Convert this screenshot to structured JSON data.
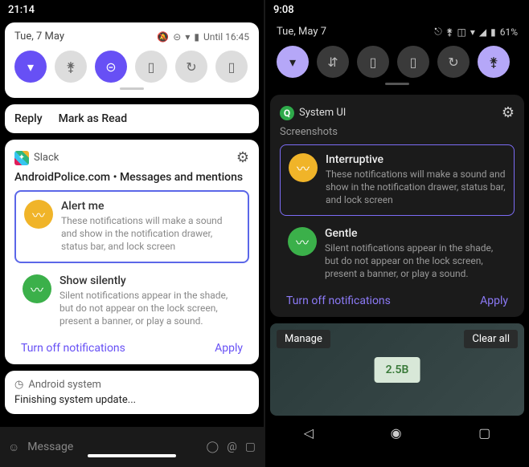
{
  "left": {
    "time": "21:14",
    "date": "Tue, 7 May",
    "battery_status": "Until 16:45",
    "toggles": [
      "wifi",
      "bluetooth",
      "dnd",
      "flashlight",
      "rotate",
      "battery"
    ],
    "active_toggles": [
      true,
      false,
      true,
      false,
      false,
      false
    ],
    "actions": {
      "reply": "Reply",
      "mark": "Mark as Read"
    },
    "slack": {
      "app": "Slack",
      "header": "AndroidPolice.com • Messages and mentions",
      "options": [
        {
          "title": "Alert me",
          "desc": "These notifications will make a sound and show in the notification drawer, status bar, and lock screen",
          "selected": true
        },
        {
          "title": "Show silently",
          "desc": "Silent notifications appear in the shade, but do not appear on the lock screen, present a banner, or play a sound.",
          "selected": false
        }
      ],
      "turn_off": "Turn off notifications",
      "apply": "Apply"
    },
    "system_update": {
      "app": "Android system",
      "body": "Finishing system update..."
    },
    "compose_hint": "Message"
  },
  "right": {
    "time": "9:08",
    "date": "Tue, May 7",
    "battery": "61%",
    "toggles": [
      "wifi",
      "data",
      "battery",
      "flashlight",
      "rotate",
      "bluetooth"
    ],
    "active_toggles": [
      true,
      false,
      false,
      false,
      false,
      true
    ],
    "sysui": {
      "app": "System UI",
      "section": "Screenshots",
      "options": [
        {
          "title": "Interruptive",
          "desc": "These notifications will make a sound and show in the notification drawer, status bar, and lock screen",
          "selected": true
        },
        {
          "title": "Gentle",
          "desc": "Silent notifications appear in the shade, but do not appear on the lock screen, present a banner, or play a sound.",
          "selected": false
        }
      ],
      "turn_off": "Turn off notifications",
      "apply": "Apply"
    },
    "recents": {
      "manage": "Manage",
      "clear": "Clear all",
      "thumb_label": "2.5B"
    }
  }
}
